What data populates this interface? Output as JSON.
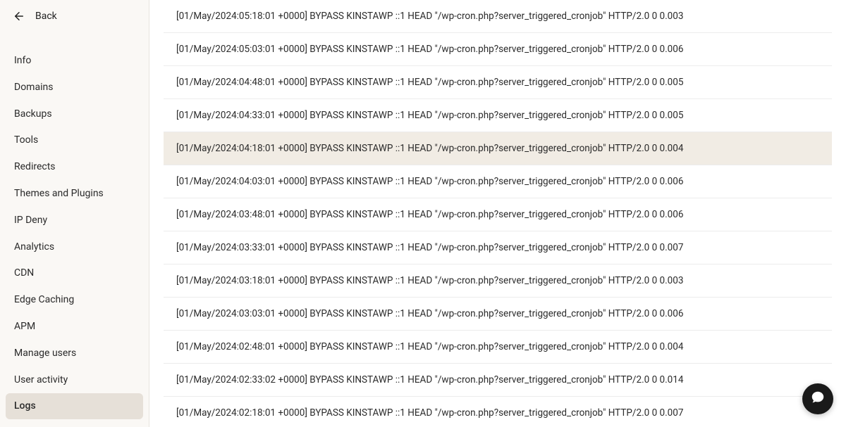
{
  "sidebar": {
    "back_label": "Back",
    "items": [
      {
        "label": "Info",
        "active": false
      },
      {
        "label": "Domains",
        "active": false
      },
      {
        "label": "Backups",
        "active": false
      },
      {
        "label": "Tools",
        "active": false
      },
      {
        "label": "Redirects",
        "active": false
      },
      {
        "label": "Themes and Plugins",
        "active": false
      },
      {
        "label": "IP Deny",
        "active": false
      },
      {
        "label": "Analytics",
        "active": false
      },
      {
        "label": "CDN",
        "active": false
      },
      {
        "label": "Edge Caching",
        "active": false
      },
      {
        "label": "APM",
        "active": false
      },
      {
        "label": "Manage users",
        "active": false
      },
      {
        "label": "User activity",
        "active": false
      },
      {
        "label": "Logs",
        "active": true
      }
    ]
  },
  "logs": [
    {
      "text": "[01/May/2024:05:18:01 +0000] BYPASS KINSTAWP ::1 HEAD \"/wp-cron.php?server_triggered_cronjob\" HTTP/2.0 0 0.003",
      "highlight": false
    },
    {
      "text": "[01/May/2024:05:03:01 +0000] BYPASS KINSTAWP ::1 HEAD \"/wp-cron.php?server_triggered_cronjob\" HTTP/2.0 0 0.006",
      "highlight": false
    },
    {
      "text": "[01/May/2024:04:48:01 +0000] BYPASS KINSTAWP ::1 HEAD \"/wp-cron.php?server_triggered_cronjob\" HTTP/2.0 0 0.005",
      "highlight": false
    },
    {
      "text": "[01/May/2024:04:33:01 +0000] BYPASS KINSTAWP ::1 HEAD \"/wp-cron.php?server_triggered_cronjob\" HTTP/2.0 0 0.005",
      "highlight": false
    },
    {
      "text": "[01/May/2024:04:18:01 +0000] BYPASS KINSTAWP ::1 HEAD \"/wp-cron.php?server_triggered_cronjob\" HTTP/2.0 0 0.004",
      "highlight": true
    },
    {
      "text": "[01/May/2024:04:03:01 +0000] BYPASS KINSTAWP ::1 HEAD \"/wp-cron.php?server_triggered_cronjob\" HTTP/2.0 0 0.006",
      "highlight": false
    },
    {
      "text": "[01/May/2024:03:48:01 +0000] BYPASS KINSTAWP ::1 HEAD \"/wp-cron.php?server_triggered_cronjob\" HTTP/2.0 0 0.006",
      "highlight": false
    },
    {
      "text": "[01/May/2024:03:33:01 +0000] BYPASS KINSTAWP ::1 HEAD \"/wp-cron.php?server_triggered_cronjob\" HTTP/2.0 0 0.007",
      "highlight": false
    },
    {
      "text": "[01/May/2024:03:18:01 +0000] BYPASS KINSTAWP ::1 HEAD \"/wp-cron.php?server_triggered_cronjob\" HTTP/2.0 0 0.003",
      "highlight": false
    },
    {
      "text": "[01/May/2024:03:03:01 +0000] BYPASS KINSTAWP ::1 HEAD \"/wp-cron.php?server_triggered_cronjob\" HTTP/2.0 0 0.006",
      "highlight": false
    },
    {
      "text": "[01/May/2024:02:48:01 +0000] BYPASS KINSTAWP ::1 HEAD \"/wp-cron.php?server_triggered_cronjob\" HTTP/2.0 0 0.004",
      "highlight": false
    },
    {
      "text": "[01/May/2024:02:33:02 +0000] BYPASS KINSTAWP ::1 HEAD \"/wp-cron.php?server_triggered_cronjob\" HTTP/2.0 0 0.014",
      "highlight": false
    },
    {
      "text": "[01/May/2024:02:18:01 +0000] BYPASS KINSTAWP ::1 HEAD \"/wp-cron.php?server_triggered_cronjob\" HTTP/2.0 0 0.007",
      "highlight": false
    }
  ]
}
